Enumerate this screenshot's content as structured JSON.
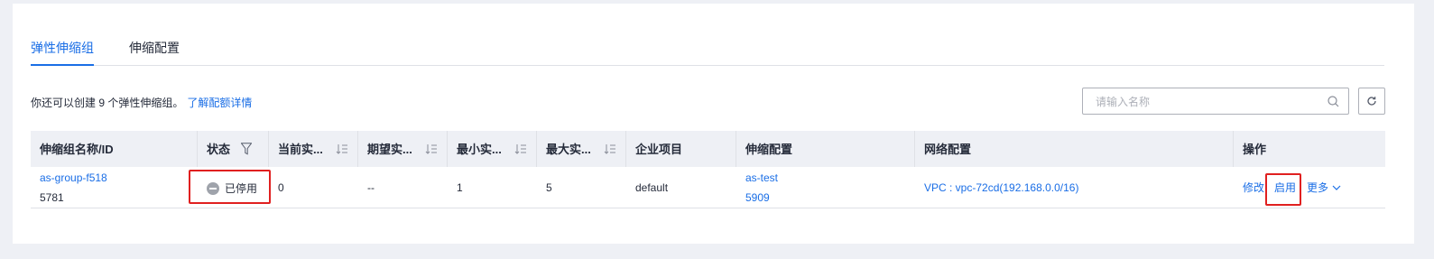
{
  "tabs": [
    {
      "label": "弹性伸缩组"
    },
    {
      "label": "伸缩配置"
    }
  ],
  "quota": {
    "text": "你还可以创建 9 个弹性伸缩组。",
    "link": "了解配额详情"
  },
  "search": {
    "placeholder": "请输入名称",
    "value": ""
  },
  "table": {
    "headers": {
      "name": "伸缩组名称/ID",
      "status": "状态",
      "current": "当前实...",
      "desired": "期望实...",
      "min": "最小实...",
      "max": "最大实...",
      "project": "企业项目",
      "config": "伸缩配置",
      "network": "网络配置",
      "actions": "操作"
    },
    "rows": [
      {
        "name": "as-group-f518",
        "id": "5781",
        "status": "已停用",
        "current": "0",
        "desired": "--",
        "min": "1",
        "max": "5",
        "project": "default",
        "config_name": "as-test",
        "config_id": "5909",
        "network": "VPC : vpc-72cd(192.168.0.0/16)",
        "actions": {
          "modify": "修改",
          "enable": "启用",
          "more": "更多"
        }
      }
    ]
  },
  "icons": {
    "search": "search-icon",
    "refresh": "refresh-icon",
    "filter": "filter-icon",
    "sort": "sort-icon",
    "status": "stopped-status-icon",
    "more": "chevron-down-icon"
  },
  "colors": {
    "accent": "#1a6ee6",
    "highlight": "#e02020",
    "stopped": "#9fa3ab"
  }
}
